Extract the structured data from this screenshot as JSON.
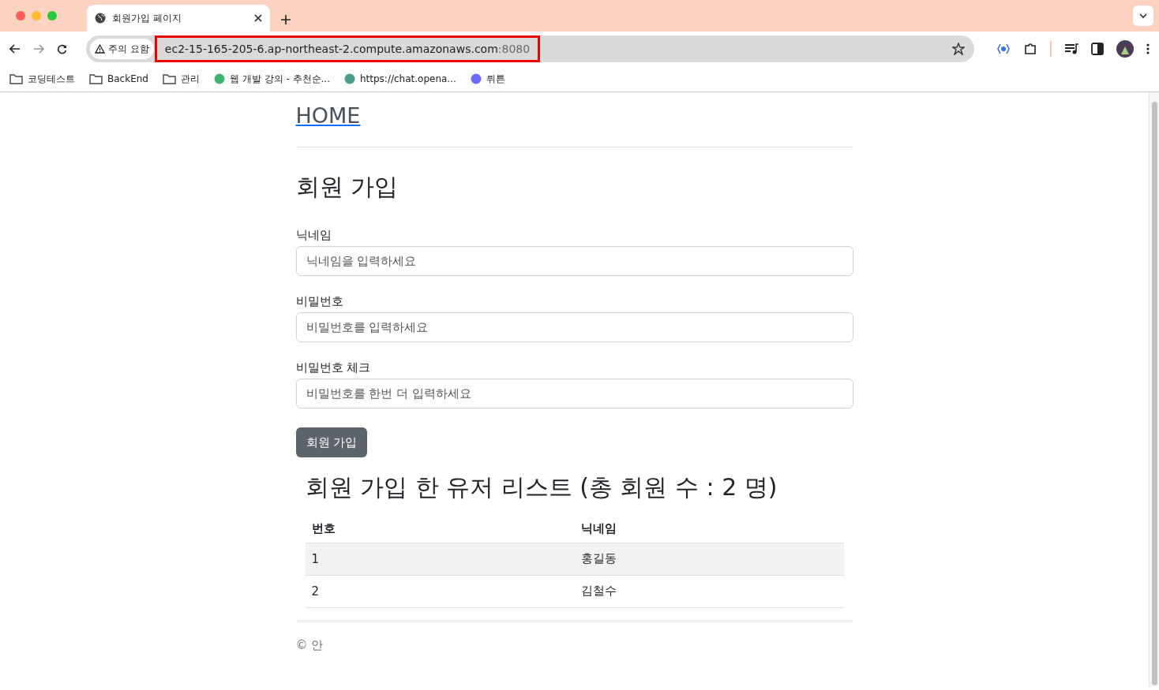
{
  "browser": {
    "tab": {
      "title": "회원가입 페이지",
      "selected": true
    },
    "security": "주의 요함",
    "url_host": "ec2-15-165-205-6.ap-northeast-2.compute.amazonaws.com",
    "url_port": ":8080",
    "url_highlighted": true,
    "bookmarks": [
      {
        "kind": "folder",
        "label": "코딩테스트"
      },
      {
        "kind": "folder",
        "label": "BackEnd"
      },
      {
        "kind": "folder",
        "label": "관리"
      },
      {
        "kind": "site",
        "label": "웹 개발 강의 - 추천순...",
        "color": "#3cb371"
      },
      {
        "kind": "site",
        "label": "https://chat.opena...",
        "color": "#4a9d86"
      },
      {
        "kind": "site",
        "label": "뤼튼",
        "color": "#6b6cf6"
      }
    ]
  },
  "page": {
    "home_link": "HOME",
    "title": "회원 가입",
    "fields": [
      {
        "label": "닉네임",
        "placeholder": "닉네임을 입력하세요"
      },
      {
        "label": "비밀번호",
        "placeholder": "비밀번호를 입력하세요"
      },
      {
        "label": "비밀번호 체크",
        "placeholder": "비밀번호를 한번 더 입력하세요"
      }
    ],
    "submit": "회원 가입",
    "list_title": "회원 가입 한 유저 리스트 (총 회원 수 : 2 명)",
    "table": {
      "columns": [
        "번호",
        "닉네임"
      ],
      "rows": [
        {
          "cells": [
            "1",
            "홍길동"
          ],
          "highlighted": true
        },
        {
          "cells": [
            "2",
            "김철수"
          ],
          "highlighted": false
        }
      ]
    },
    "footer": "© 안"
  }
}
